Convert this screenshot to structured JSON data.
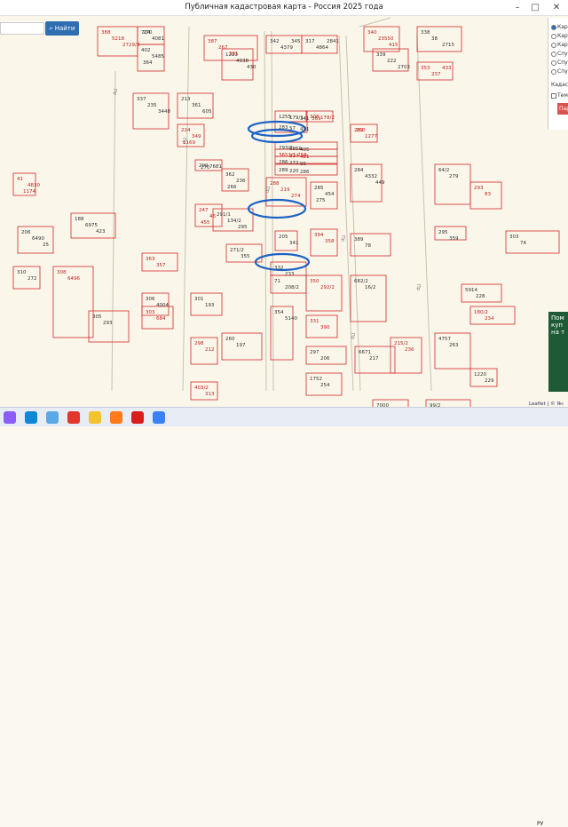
{
  "window": {
    "title": "Публичная кадастровая карта - Россия 2025 года"
  },
  "search": {
    "placeholder": "",
    "button": "Найти"
  },
  "panel": {
    "options": [
      "Кар",
      "Кар",
      "Кар",
      "Спу",
      "Спу",
      "Спу"
    ],
    "section": "Кадас",
    "checkbox": "Тем",
    "apply": "Пар"
  },
  "ad": {
    "text": "Пом куп на т"
  },
  "attribution": "Leaflet | © Ян",
  "taskbar": {
    "icons": [
      "purple-app",
      "edge",
      "apps",
      "yandex-browser",
      "explorer",
      "firefox",
      "yandex",
      "weather"
    ],
    "tray": "РУ"
  },
  "map": {
    "labels": [
      "388",
      "724",
      "402",
      "387",
      "342",
      "317",
      "340",
      "339",
      "338",
      "353",
      "337",
      "213",
      "224",
      "1223",
      "1255",
      "308",
      "283",
      "293/2",
      "3651/1 258",
      "286",
      "289",
      "288",
      "285",
      "284",
      "282",
      "362",
      "299",
      "247",
      "291/1",
      "188",
      "41",
      "206",
      "205",
      "394",
      "389",
      "64/2",
      "293",
      "295",
      "303",
      "363",
      "271/2",
      "71",
      "350",
      "682/2",
      "354",
      "331",
      "332",
      "310",
      "308",
      "306",
      "305",
      "303",
      "301",
      "260",
      "298",
      "297",
      "6671",
      "215/2",
      "4757",
      "5914",
      "180/2",
      "1220",
      "1752",
      "403/2",
      "7000",
      "99/2",
      "5218",
      "4081",
      "5485",
      "267",
      "4379",
      "4864",
      "23550",
      "222",
      "38",
      "237",
      "235",
      "361",
      "349",
      "4938",
      "179/1",
      "178/2",
      "57",
      "6859",
      "324",
      "272",
      "220",
      "219",
      "454",
      "4332",
      "1277",
      "236",
      "7681",
      "46",
      "134/2",
      "6975",
      "4830",
      "6490",
      "341",
      "358",
      "78",
      "279",
      "83",
      "359",
      "74",
      "357",
      "355",
      "208/2",
      "292/2",
      "16/2",
      "5140",
      "390",
      "233",
      "272",
      "6496",
      "4004",
      "293",
      "684",
      "193",
      "197",
      "212",
      "206",
      "217",
      "236",
      "263",
      "228",
      "234",
      "229",
      "254",
      "313",
      "264",
      "274",
      "2729/3",
      "270",
      "364",
      "361",
      "345",
      "2841",
      "415",
      "2703",
      "2715",
      "433",
      "3448",
      "605",
      "1169",
      "430",
      "341",
      "369",
      "431",
      "405",
      "421",
      "95",
      "286",
      "274",
      "275",
      "449",
      "260",
      "266",
      "270",
      "455",
      "295",
      "423",
      "1174",
      "25"
    ],
    "road_labels": [
      "Пр",
      "Пр",
      "Пр",
      "Пр",
      "Пр",
      "Пр"
    ],
    "highlight_count": 4
  }
}
